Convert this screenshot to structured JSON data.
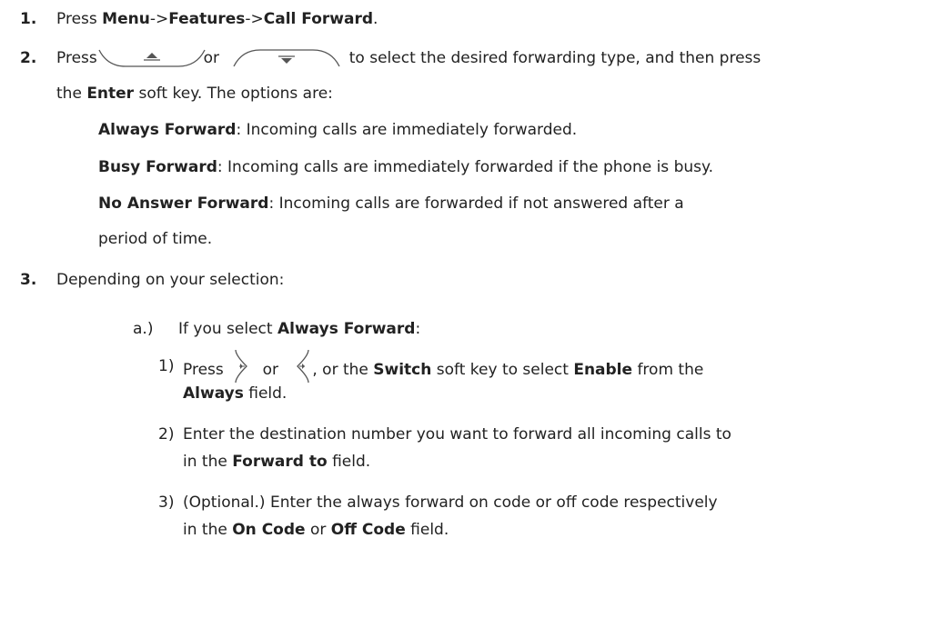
{
  "steps": [
    {
      "number": "1.",
      "line1": {
        "press": "Press ",
        "menu": "Menu",
        "arrow1": "->",
        "features": "Features",
        "arrow2": "->",
        "call_forward": "Call Forward",
        "period": "."
      }
    },
    {
      "number": "2.",
      "line1": {
        "press": "Press ",
        "or": "or",
        "rest": "to select the desired forwarding type, and then press"
      },
      "line2": {
        "the": "the ",
        "enter": "Enter",
        "rest": " soft key. The options are:"
      },
      "options": [
        {
          "name": "Always Forward",
          "desc": ": Incoming calls are immediately forwarded."
        },
        {
          "name": "Busy Forward",
          "desc": ": Incoming calls are immediately forwarded if the phone is busy."
        },
        {
          "name": "No Answer Forward",
          "desc": ": Incoming calls are forwarded if not answered after a",
          "desc2": "period of time."
        }
      ]
    },
    {
      "number": "3.",
      "text": "Depending on your selection:",
      "sub": {
        "label": "a.)",
        "intro": "If you select ",
        "name": "Always Forward",
        "colon": ":",
        "items": [
          {
            "num": "1)",
            "press": "Press",
            "or": "or",
            "rest1": ", or the ",
            "switch": "Switch",
            "rest2": " soft key to select ",
            "enable": "Enable",
            "rest3": " from the",
            "always": "Always",
            "rest4": " field."
          },
          {
            "num": "2)",
            "text": "Enter the destination number you want to forward all incoming calls to",
            "in": "in the ",
            "field": "Forward to",
            "rest": " field."
          },
          {
            "num": "3)",
            "text": "(Optional.) Enter the always forward on code or off code respectively",
            "in": "in the ",
            "on": "On Code",
            "or": " or ",
            "off": "Off Code",
            "rest": " field."
          }
        ]
      }
    }
  ],
  "icons": [
    "up-key-icon",
    "down-key-icon",
    "right-key-icon",
    "left-key-icon"
  ]
}
